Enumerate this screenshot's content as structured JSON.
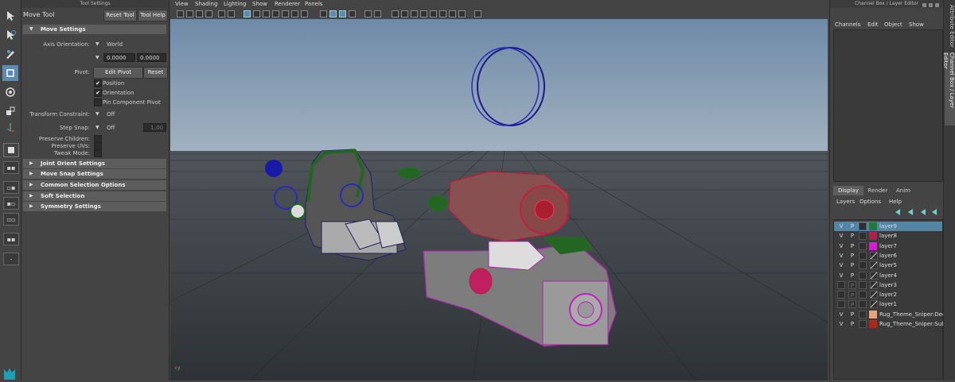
{
  "tool_settings": {
    "pane_title": "Tool Settings",
    "tool_name": "Move Tool",
    "reset_tool": "Reset Tool",
    "tool_help": "Tool Help",
    "move_settings": {
      "header": "Move Settings",
      "axis_orientation_label": "Axis Orientation:",
      "axis_orientation_value": "World",
      "offset_1": "0.0000",
      "offset_2": "0.0000",
      "pivot_label": "Pivot:",
      "edit_pivot": "Edit Pivot",
      "reset": "Reset",
      "position_label": "Position",
      "orientation_label": "Orientation",
      "pin_component_label": "Pin Component Pivot",
      "transform_constraint_label": "Transform Constraint:",
      "transform_constraint_value": "Off",
      "step_snap_label": "Step Snap:",
      "step_snap_value": "Off",
      "step_snap_amount": "1.00",
      "preserve_children_label": "Preserve Children:",
      "preserve_uvs_label": "Preserve UVs:",
      "tweak_mode_label": "Tweak Mode:"
    },
    "sections": [
      "Joint Orient Settings",
      "Move Snap Settings",
      "Common Selection Options",
      "Soft Selection",
      "Symmetry Settings"
    ]
  },
  "viewport": {
    "menus": [
      "View",
      "Shading",
      "Lighting",
      "Show",
      "Renderer",
      "Panels"
    ],
    "axis_x": "x",
    "axis_y": "y"
  },
  "channel_box": {
    "pane_title": "Channel Box / Layer Editor",
    "menus": [
      "Channels",
      "Edit",
      "Object",
      "Show"
    ],
    "tabs": [
      "Display",
      "Render",
      "Anim"
    ],
    "layer_menus": [
      "Layers",
      "Options",
      "Help"
    ],
    "layers": [
      {
        "v": "V",
        "p": "P",
        "color": "#1e7a3a",
        "name": "layer9",
        "selected": true
      },
      {
        "v": "V",
        "p": "P",
        "color": "#b0204a",
        "name": "layer8"
      },
      {
        "v": "V",
        "p": "P",
        "color": "#d020d0",
        "name": "layer7"
      },
      {
        "v": "V",
        "p": "P",
        "color": "",
        "name": "layer6"
      },
      {
        "v": "V",
        "p": "P",
        "color": "",
        "name": "layer5"
      },
      {
        "v": "V",
        "p": "P",
        "color": "",
        "name": "layer4"
      },
      {
        "v": "",
        "p": "P",
        "color": "",
        "name": "layer3"
      },
      {
        "v": "",
        "p": "P",
        "color": "",
        "name": "layer2"
      },
      {
        "v": "",
        "p": "P",
        "color": "",
        "name": "layer1"
      },
      {
        "v": "V",
        "p": "P",
        "color": "#e3a47c",
        "name": "Rug_Theme_Sniper:Deca"
      },
      {
        "v": "V",
        "p": "P",
        "color": "#a82a1a",
        "name": "Rug_Theme_Sniper:Subs"
      }
    ]
  },
  "side_tabs": [
    "Attribute Editor",
    "Channel Box / Layer Editor"
  ]
}
